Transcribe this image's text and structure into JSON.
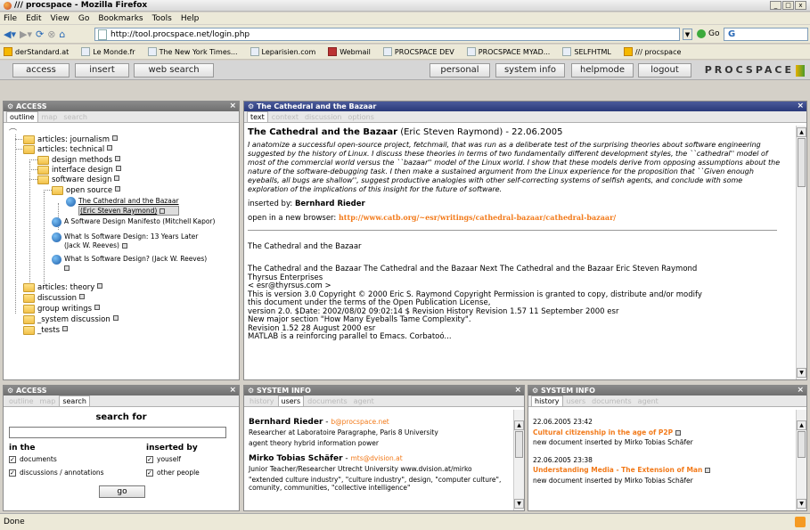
{
  "window": {
    "title": "/// procspace - Mozilla Firefox"
  },
  "menu": [
    "File",
    "Edit",
    "View",
    "Go",
    "Bookmarks",
    "Tools",
    "Help"
  ],
  "nav": {
    "url": "http://tool.procspace.net/login.php",
    "go_label": "Go"
  },
  "bookmarks": [
    "derStandard.at",
    "Le Monde.fr",
    "The New York Times...",
    "Leparisien.com",
    "Webmail",
    "PROCSPACE DEV",
    "PROCSPACE MYAD...",
    "SELFHTML",
    "/// procspace"
  ],
  "app": {
    "left_buttons": [
      "access",
      "insert",
      "web search"
    ],
    "right_buttons": [
      "personal",
      "system info",
      "helpmode",
      "logout"
    ],
    "brand": "PROCSPACE"
  },
  "access_panel": {
    "title": "ACCESS",
    "tabs": [
      "outline",
      "map",
      "search"
    ],
    "tree": [
      {
        "label": "articles: journalism",
        "type": "folder"
      },
      {
        "label": "articles: technical",
        "type": "folder"
      },
      {
        "label": "design methods",
        "type": "folder"
      },
      {
        "label": "interface design",
        "type": "folder"
      },
      {
        "label": "software design",
        "type": "folder"
      },
      {
        "label": "open source",
        "type": "folder"
      },
      {
        "label": "The Cathedral and the Bazaar",
        "label2": "(Eric Steven Raymond)",
        "type": "doc"
      },
      {
        "label": "A Software Design Manifesto (Mitchell Kapor)",
        "type": "doc"
      },
      {
        "label": "What Is Software Design: 13 Years Later",
        "label2": "(Jack W. Reeves)",
        "type": "doc"
      },
      {
        "label": "What Is Software Design? (Jack W. Reeves)",
        "type": "doc"
      },
      {
        "label": "articles: theory",
        "type": "folder"
      },
      {
        "label": "discussion",
        "type": "folder"
      },
      {
        "label": "group writings",
        "type": "folder"
      },
      {
        "label": "_system discussion",
        "type": "folder"
      },
      {
        "label": "_tests",
        "type": "folder"
      }
    ]
  },
  "doc_panel": {
    "title": "The Cathedral and the Bazaar",
    "tabs": [
      "text",
      "context",
      "discussion",
      "options"
    ],
    "heading": "The Cathedral and the Bazaar",
    "heading_meta": "(Eric Steven Raymond) - 22.06.2005",
    "abstract": "I anatomize a successful open-source project, fetchmail, that was run as a deliberate test of the surprising theories about software engineering suggested by the history of Linux. I discuss these theories in terms of two fundamentally different development styles, the ``cathedral'' model of most of the commercial world versus the ``bazaar'' model of the Linux world. I show that these models derive from opposing assumptions about the nature of the software-debugging task. I then make a sustained argument from the Linux experience for the proposition that ``Given enough eyeballs, all bugs are shallow'', suggest productive analogies with other self-correcting systems of selfish agents, and conclude with some exploration of the implications of this insight for the future of software.",
    "inserted_by_label": "inserted by:",
    "inserted_by": "Bernhard Rieder",
    "open_label": "open in a new browser:",
    "open_url": "http://www.catb.org/~esr/writings/cathedral-bazaar/cathedral-bazaar/",
    "section_title": "The Cathedral and the Bazaar",
    "body": [
      "The Cathedral and the Bazaar The Cathedral and the Bazaar      Next The Cathedral and the Bazaar Eric Steven Raymond",
      "Thyrsus Enterprises",
      "< esr@thyrsus.com >",
      "This is version 3.0 Copyright © 2000 Eric S. Raymond Copyright Permission is granted to copy, distribute and/or modify",
      "this document under the terms of the Open Publication License,",
      "version 2.0. $Date: 2002/08/02 09:02:14 $ Revision History Revision 1.57 11 September 2000 esr",
      "New major section \"How Many Eyeballs Tame Complexity\".",
      "Revision 1.52 28 August 2000 esr",
      "MATLAB is a reinforcing parallel to Emacs. Corbatoó..."
    ]
  },
  "search_panel": {
    "title": "ACCESS",
    "tabs": [
      "outline",
      "map",
      "search"
    ],
    "heading": "search for",
    "in_the": "in the",
    "inserted_by": "inserted by",
    "options_left": [
      "documents",
      "discussions / annotations"
    ],
    "options_right": [
      "youself",
      "other people"
    ],
    "go": "go"
  },
  "sysinfo_users": {
    "title": "SYSTEM INFO",
    "tabs": [
      "history",
      "users",
      "documents",
      "agent"
    ],
    "users": [
      {
        "name": "Bernhard Rieder",
        "email": "b@procspace.net",
        "line1": "Researcher at Laboratoire Paragraphe, Paris 8 University",
        "line2": "agent theory hybrid information power"
      },
      {
        "name": "Mirko Tobias Schäfer",
        "email": "mts@dvision.at",
        "line1": "Junior Teacher/Researcher Utrecht University www.dvision.at/mirko",
        "line2": "\"extended culture industry\", \"culture industry\", design, \"computer culture\", comunity, communities, \"collective intelligence\""
      }
    ]
  },
  "sysinfo_history": {
    "title": "SYSTEM INFO",
    "tabs": [
      "history",
      "users",
      "documents",
      "agent"
    ],
    "entries": [
      {
        "time": "22.06.2005 23:42",
        "title": "Cultural citizenship in the age of P2P",
        "note": "new document inserted by Mirko Tobias Schäfer"
      },
      {
        "time": "22.06.2005 23:38",
        "title": "Understanding Media - The Extension of Man",
        "note": "new document inserted by Mirko Tobias Schäfer"
      }
    ]
  },
  "status": {
    "text": "Done"
  }
}
